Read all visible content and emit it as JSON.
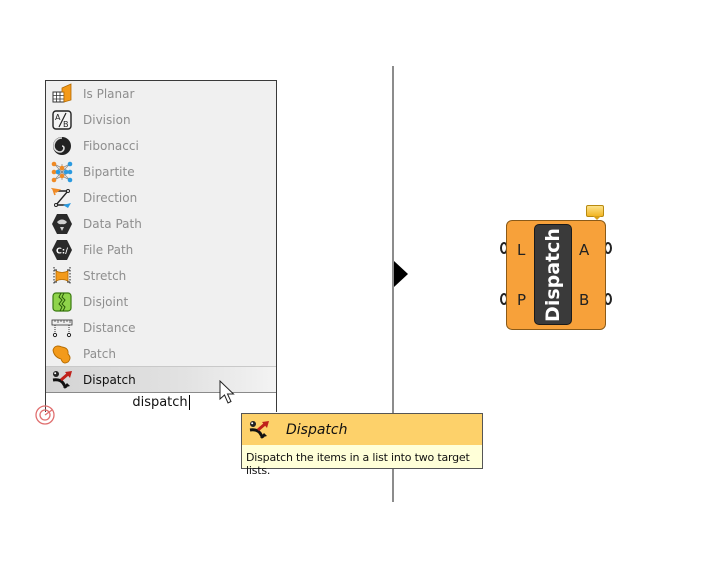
{
  "search_popup": {
    "items": [
      {
        "label": "Is Planar",
        "icon": "is-planar-icon"
      },
      {
        "label": "Division",
        "icon": "division-icon"
      },
      {
        "label": "Fibonacci",
        "icon": "fibonacci-icon"
      },
      {
        "label": "Bipartite",
        "icon": "bipartite-icon"
      },
      {
        "label": "Direction",
        "icon": "direction-icon"
      },
      {
        "label": "Data Path",
        "icon": "data-path-icon"
      },
      {
        "label": "File Path",
        "icon": "file-path-icon"
      },
      {
        "label": "Stretch",
        "icon": "stretch-icon"
      },
      {
        "label": "Disjoint",
        "icon": "disjoint-icon"
      },
      {
        "label": "Distance",
        "icon": "distance-icon"
      },
      {
        "label": "Patch",
        "icon": "patch-icon"
      },
      {
        "label": "Dispatch",
        "icon": "dispatch-icon",
        "selected": true
      }
    ],
    "query": "dispatch"
  },
  "tooltip": {
    "title": "Dispatch",
    "description": "Dispatch the items in a list into two target lists."
  },
  "component": {
    "name": "Dispatch",
    "inputs": [
      "L",
      "P"
    ],
    "outputs": [
      "A",
      "B"
    ],
    "color": "#f7a13a"
  },
  "file_path_icon_text": "C:/",
  "division_icon_text": "A/B"
}
